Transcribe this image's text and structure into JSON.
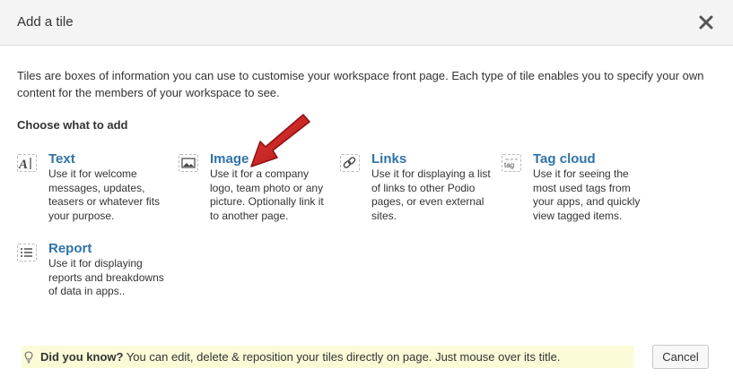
{
  "dialog": {
    "title": "Add a tile"
  },
  "intro": "Tiles are boxes of information you can use to customise your workspace front page. Each type of tile enables you to specify your own content for the members of your workspace to see.",
  "section_title": "Choose what to add",
  "tiles": [
    {
      "name": "Text",
      "description": "Use it for welcome messages, updates, teasers or whatever fits your purpose.",
      "icon": "text-icon"
    },
    {
      "name": "Image",
      "description": "Use it for a company logo, team photo or any picture. Optionally link it to another page.",
      "icon": "image-icon"
    },
    {
      "name": "Links",
      "description": "Use it for displaying a list of links to other Podio pages, or even external sites.",
      "icon": "link-icon"
    },
    {
      "name": "Tag cloud",
      "description": "Use it for seeing the most used tags from your apps, and quickly view tagged items.",
      "icon": "tag-cloud-icon",
      "icon_text": "tag"
    },
    {
      "name": "Report",
      "description": "Use it for displaying reports and breakdowns of data in apps..",
      "icon": "report-icon"
    }
  ],
  "tip": {
    "lead": "Did you know?",
    "text": " You can edit, delete & reposition your tiles directly on page. Just mouse over its title.",
    "icon": "lightbulb-icon"
  },
  "buttons": {
    "cancel": "Cancel"
  },
  "colors": {
    "link": "#2f73a8",
    "arrow": "#c0201c",
    "tip_background": "#fbfbd8",
    "header_background": "#f4f4f4"
  }
}
